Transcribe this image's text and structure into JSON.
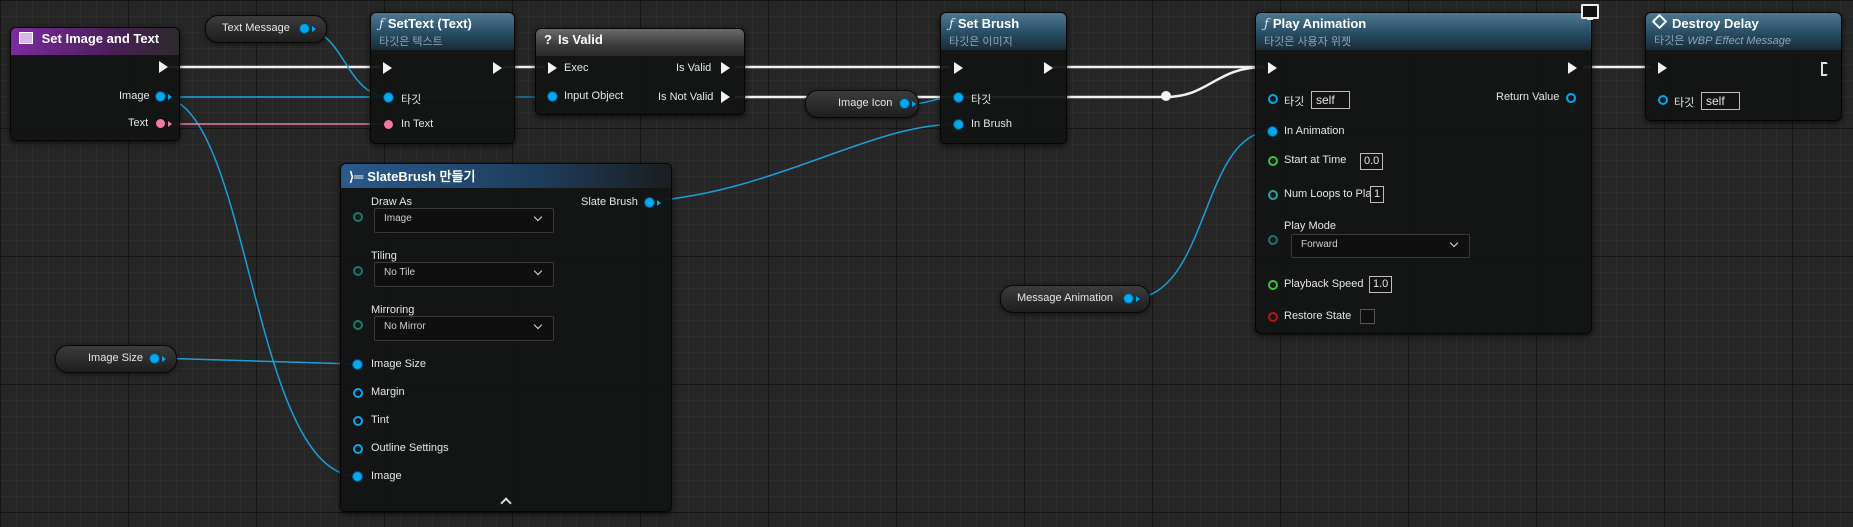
{
  "nodes": {
    "event": {
      "title": "Set Image and Text",
      "pins": {
        "image": "Image",
        "text": "Text"
      }
    },
    "set_text": {
      "title": "SetText (Text)",
      "subtitle": "타깃은 텍스트",
      "pins": {
        "target": "타깃",
        "in_text": "In Text"
      }
    },
    "is_valid": {
      "title": "Is Valid",
      "glyph": "?",
      "pins": {
        "exec": "Exec",
        "input_object": "Input Object",
        "is_valid": "Is Valid",
        "is_not_valid": "Is Not Valid"
      }
    },
    "set_brush": {
      "title": "Set Brush",
      "subtitle": "타깃은 이미지",
      "pins": {
        "target": "타깃",
        "in_brush": "In Brush"
      }
    },
    "play_animation": {
      "title": "Play Animation",
      "subtitle": "타깃은 사용자 위젯",
      "pins": {
        "target": "타깃",
        "target_value": "self",
        "return_value": "Return Value",
        "in_animation": "In Animation",
        "start_at_time": "Start at Time",
        "start_at_time_value": "0.0",
        "num_loops": "Num Loops to Play",
        "num_loops_value": "1",
        "play_mode": "Play Mode",
        "play_mode_value": "Forward",
        "playback_speed": "Playback Speed",
        "playback_speed_value": "1.0",
        "restore_state": "Restore State"
      }
    },
    "destroy_delay": {
      "title": "Destroy Delay",
      "subtitle_prefix": "타깃은 ",
      "subtitle_target": "WBP Effect Message",
      "pins": {
        "target": "타깃",
        "target_value": "self"
      }
    },
    "make_slatebrush": {
      "title": "SlateBrush 만들기",
      "pins": {
        "draw_as": "Draw As",
        "draw_as_value": "Image",
        "tiling": "Tiling",
        "tiling_value": "No Tile",
        "mirroring": "Mirroring",
        "mirroring_value": "No Mirror",
        "image_size": "Image Size",
        "margin": "Margin",
        "tint": "Tint",
        "outline_settings": "Outline Settings",
        "image": "Image",
        "slate_brush": "Slate Brush"
      }
    }
  },
  "variables": {
    "text_message": "Text Message",
    "image_icon": "Image Icon",
    "message_animation": "Message Animation",
    "image_size": "Image Size"
  },
  "colors": {
    "exec": "#f2f2f2",
    "object": "#00a8f0",
    "text": "#f07aa0",
    "float": "#35c535",
    "bool": "#c01010"
  },
  "icons": {
    "event": "widget-event-icon",
    "function": "function-icon",
    "macro": "question-icon",
    "make_struct": "make-struct-icon",
    "latent": "latent-diamond-icon",
    "monitor": "monitor-icon"
  }
}
